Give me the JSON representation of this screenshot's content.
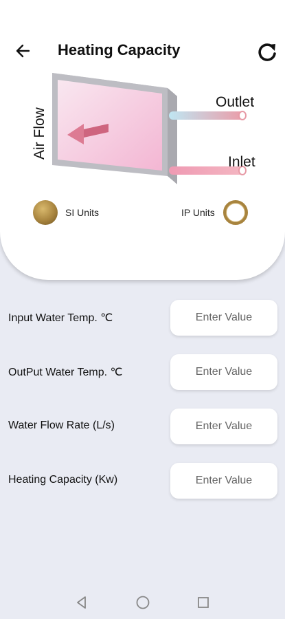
{
  "header": {
    "title": "Heating Capacity",
    "back_icon": "arrow-left-icon",
    "refresh_icon": "refresh-icon"
  },
  "diagram": {
    "airflow_label": "Air Flow",
    "outlet_label": "Outlet",
    "inlet_label": "Inlet"
  },
  "units": {
    "si_label": "SI Units",
    "ip_label": "IP Units",
    "selected": "SI Units"
  },
  "fields": [
    {
      "label": "Input Water Temp. ℃",
      "placeholder": "Enter Value",
      "value": ""
    },
    {
      "label": "OutPut Water Temp. ℃",
      "placeholder": "Enter Value",
      "value": ""
    },
    {
      "label": "Water Flow Rate (L/s)",
      "placeholder": "Enter Value",
      "value": ""
    },
    {
      "label": "Heating Capacity (Kw)",
      "placeholder": "Enter Value",
      "value": ""
    }
  ],
  "colors": {
    "background": "#e9ebf3",
    "card": "#ffffff",
    "accent_gold": "#a8843e",
    "coil_pink": "#f3b9d6"
  },
  "navbar": {
    "back_icon": "nav-back-triangle-icon",
    "home_icon": "nav-home-circle-icon",
    "recents_icon": "nav-recents-square-icon"
  }
}
